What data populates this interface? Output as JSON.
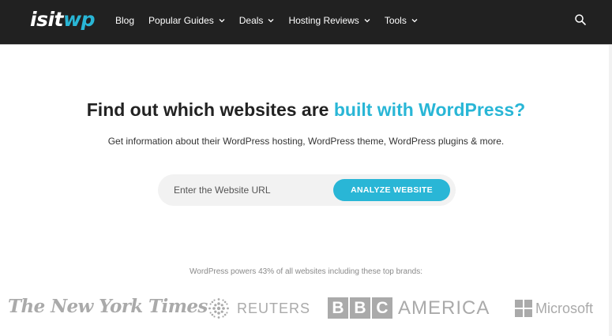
{
  "nav": {
    "logo_main": "isit",
    "logo_accent": "wp",
    "items": [
      {
        "label": "Blog",
        "dropdown": false
      },
      {
        "label": "Popular Guides",
        "dropdown": true
      },
      {
        "label": "Deals",
        "dropdown": true
      },
      {
        "label": "Hosting Reviews",
        "dropdown": true
      },
      {
        "label": "Tools",
        "dropdown": true
      }
    ],
    "search_icon": "search-icon",
    "background": "#212121"
  },
  "hero": {
    "title_plain": "Find out which websites are ",
    "title_accent": "built with WordPress?",
    "subtitle": "Get information about their WordPress hosting, WordPress theme, WordPress plugins & more.",
    "accent_color": "#29b6d6"
  },
  "form": {
    "url_placeholder": "Enter the Website URL",
    "url_value": "",
    "submit_label": "ANALYZE WEBSITE"
  },
  "brands": {
    "caption": "WordPress powers 43% of all websites including these top brands:",
    "nyt": "The New York Times",
    "reuters": "REUTERS",
    "bbc_letters": [
      "B",
      "B",
      "C"
    ],
    "bbc_word": "AMERICA",
    "microsoft": "Microsoft",
    "logo_color": "#aaaaaa"
  }
}
